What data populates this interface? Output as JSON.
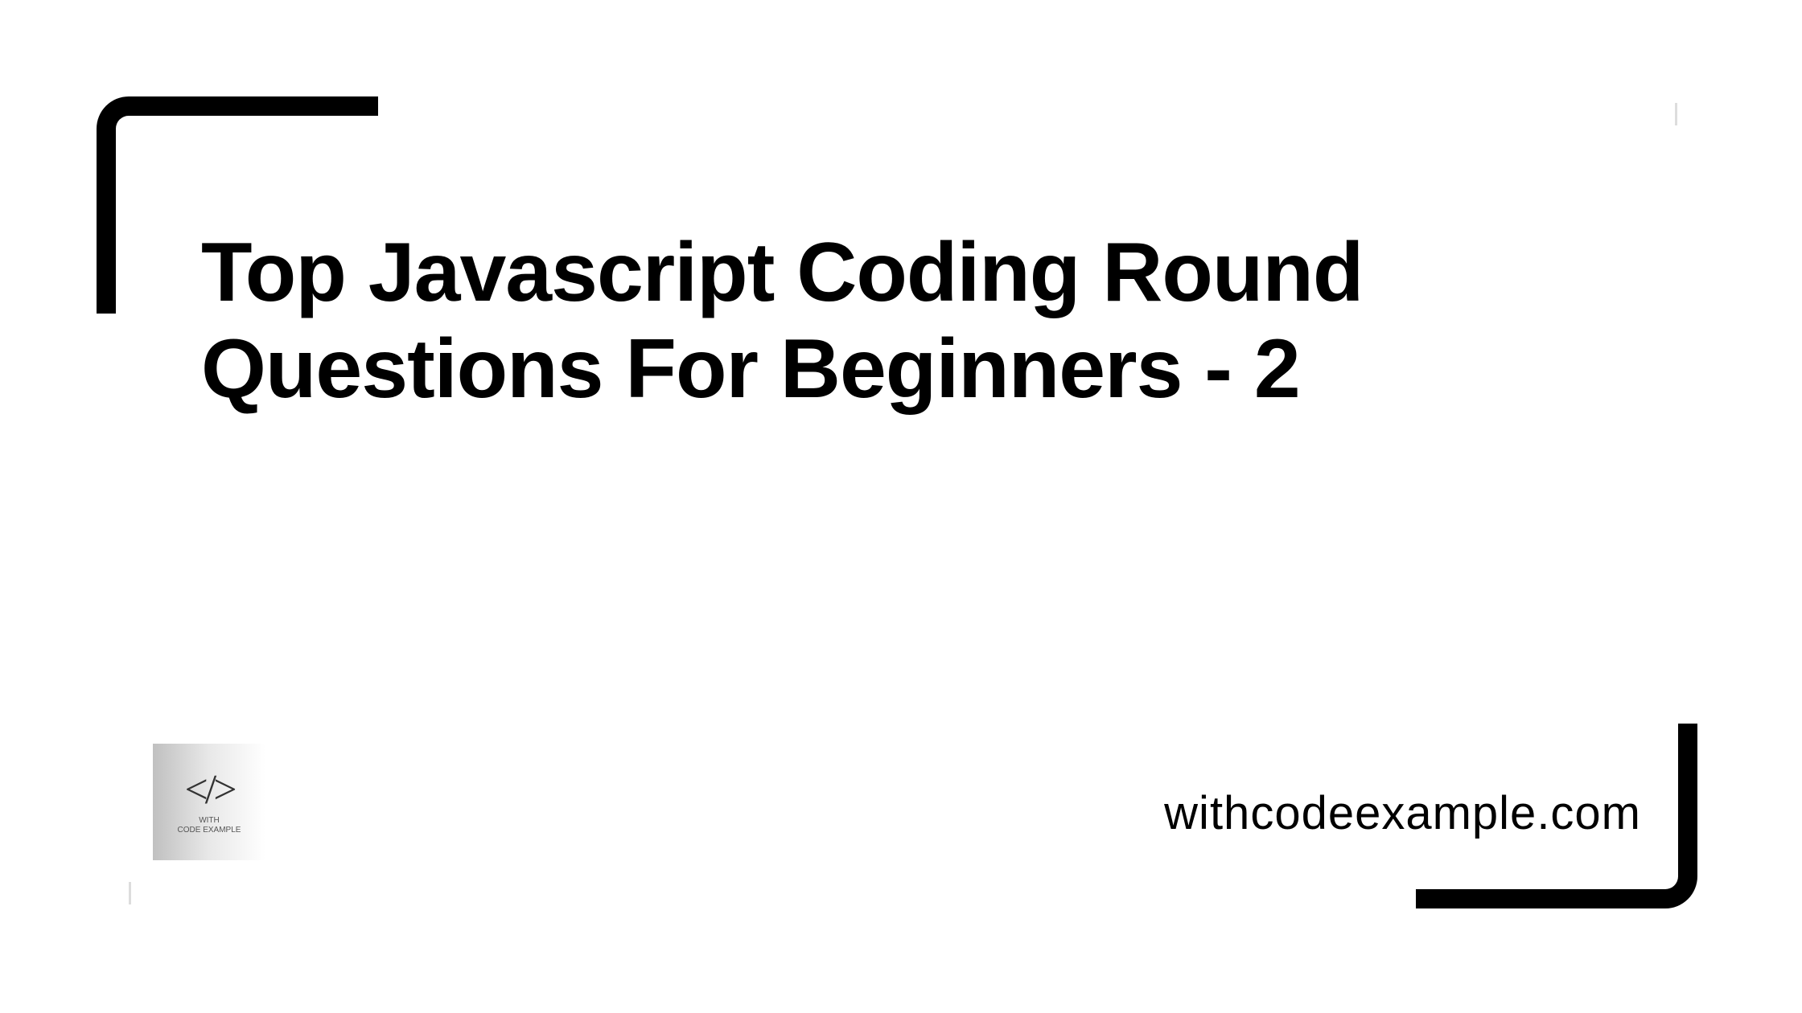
{
  "title": "Top Javascript Coding Round Questions For Beginners - 2",
  "logo": {
    "symbol": "</>",
    "line1": "WITH",
    "line2": "CODE EXAMPLE"
  },
  "website": "withcodeexample.com"
}
